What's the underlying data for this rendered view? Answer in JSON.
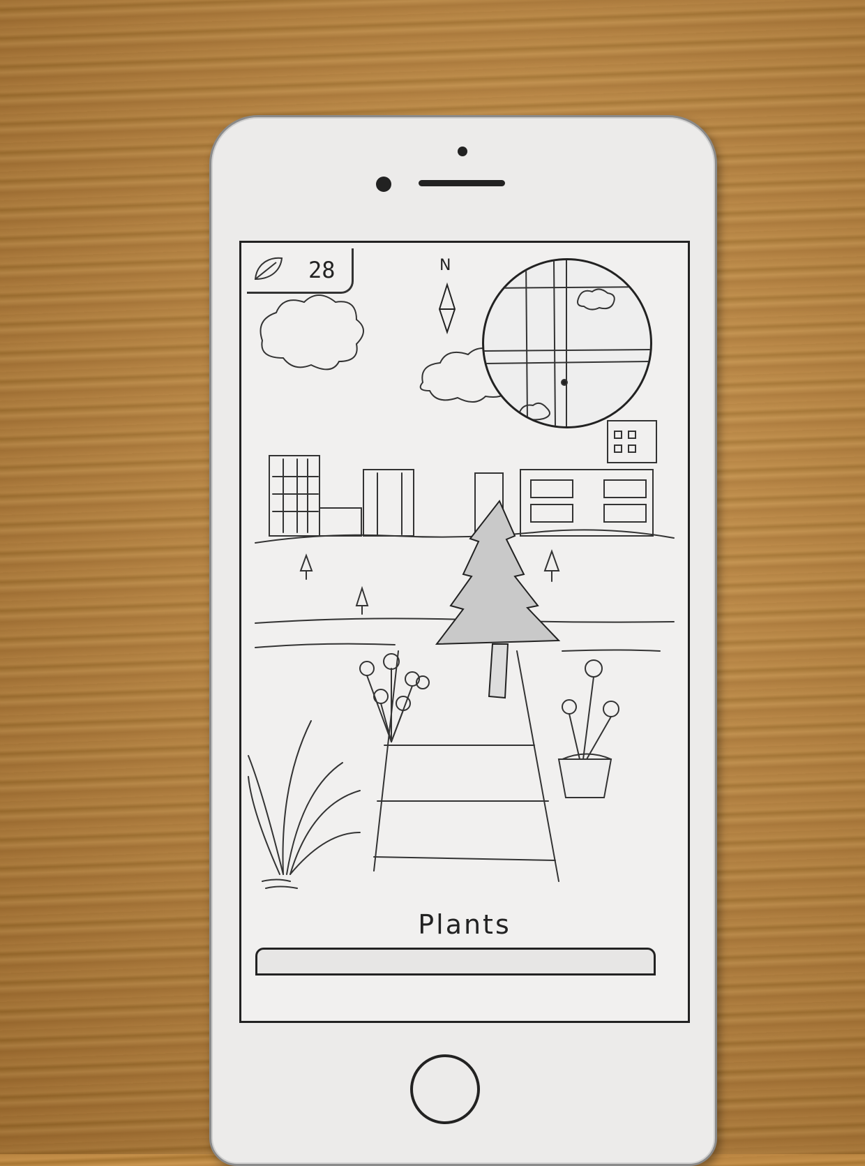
{
  "hud": {
    "coin_count": "28",
    "leaf_icon": "leaf-icon",
    "compass_label": "N"
  },
  "minimap": {
    "icon": "circular-map"
  },
  "scene": {
    "section_title": "Plants"
  },
  "colors": {
    "ink": "#222222",
    "paper": "#f1f0ef",
    "wood": "#b8833f"
  }
}
